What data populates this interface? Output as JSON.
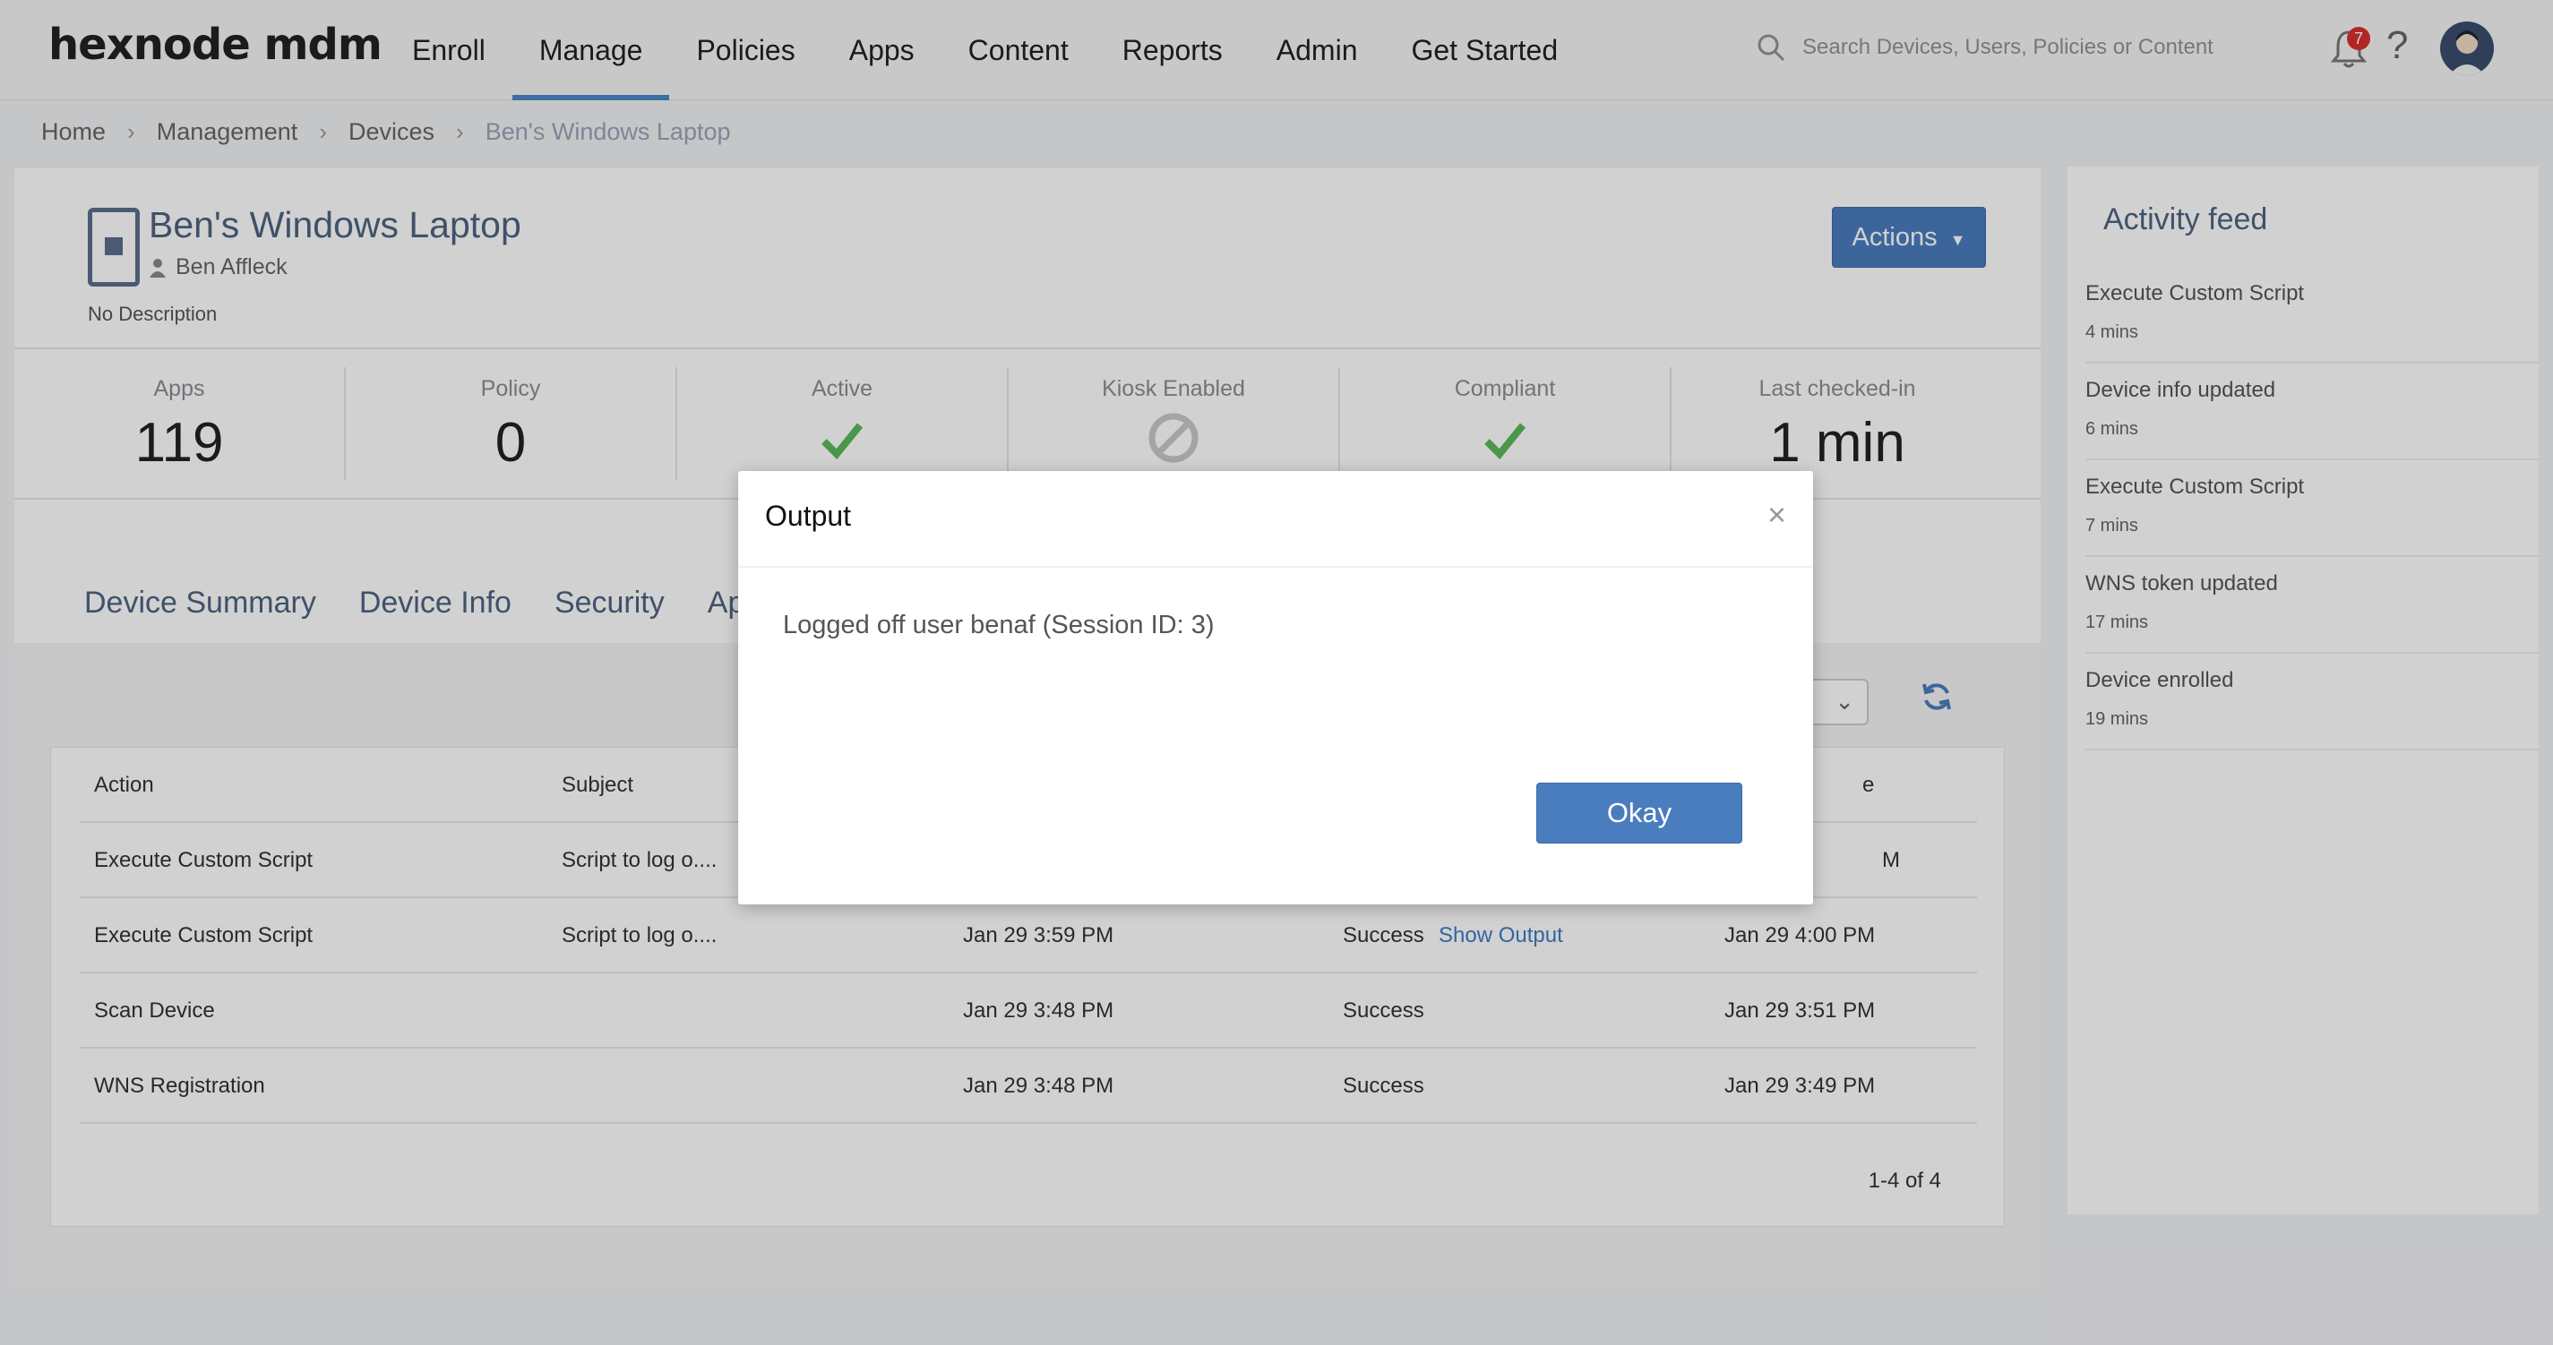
{
  "app": {
    "logo": "hexnode mdm"
  },
  "nav": {
    "items": [
      "Enroll",
      "Manage",
      "Policies",
      "Apps",
      "Content",
      "Reports",
      "Admin",
      "Get Started"
    ],
    "active": "Manage"
  },
  "search": {
    "placeholder": "Search Devices, Users, Policies or Content"
  },
  "notifications": {
    "count": "7"
  },
  "breadcrumb": [
    "Home",
    "Management",
    "Devices",
    "Ben's Windows Laptop"
  ],
  "device": {
    "name": "Ben's Windows Laptop",
    "user": "Ben Affleck",
    "description": "No Description",
    "actions_label": "Actions"
  },
  "stats": {
    "apps_label": "Apps",
    "apps_value": "119",
    "policy_label": "Policy",
    "policy_value": "0",
    "active_label": "Active",
    "kiosk_label": "Kiosk Enabled",
    "compliant_label": "Compliant",
    "last_label": "Last checked-in",
    "last_value": "1 min"
  },
  "tabs": [
    "Device Summary",
    "Device Info",
    "Security",
    "Ap"
  ],
  "table": {
    "headers": {
      "action": "Action",
      "subject": "Subject",
      "last": "e"
    },
    "rows": [
      {
        "action": "Execute Custom Script",
        "subject": "Script to log o....",
        "created": "",
        "status": "",
        "output": "",
        "updated": "M"
      },
      {
        "action": "Execute Custom Script",
        "subject": "Script to log o....",
        "created": "Jan 29 3:59 PM",
        "status": "Success",
        "output": "Show Output",
        "updated": "Jan 29 4:00 PM"
      },
      {
        "action": "Scan Device",
        "subject": "",
        "created": "Jan 29 3:48 PM",
        "status": "Success",
        "output": "",
        "updated": "Jan 29 3:51 PM"
      },
      {
        "action": "WNS Registration",
        "subject": "",
        "created": "Jan 29 3:48 PM",
        "status": "Success",
        "output": "",
        "updated": "Jan 29 3:49 PM"
      }
    ],
    "pagination": "1-4 of 4"
  },
  "feed": {
    "title": "Activity feed",
    "items": [
      {
        "text": "Execute Custom Script",
        "time": "4 mins"
      },
      {
        "text": "Device info updated",
        "time": "6 mins"
      },
      {
        "text": "Execute Custom Script",
        "time": "7 mins"
      },
      {
        "text": "WNS token updated",
        "time": "17 mins"
      },
      {
        "text": "Device enrolled",
        "time": "19 mins"
      }
    ]
  },
  "modal": {
    "title": "Output",
    "body": "Logged off user benaf (Session ID: 3)",
    "ok_label": "Okay"
  },
  "colors": {
    "accent": "#4a7dbe",
    "check": "#5cb85c",
    "badge": "#d9302e"
  }
}
